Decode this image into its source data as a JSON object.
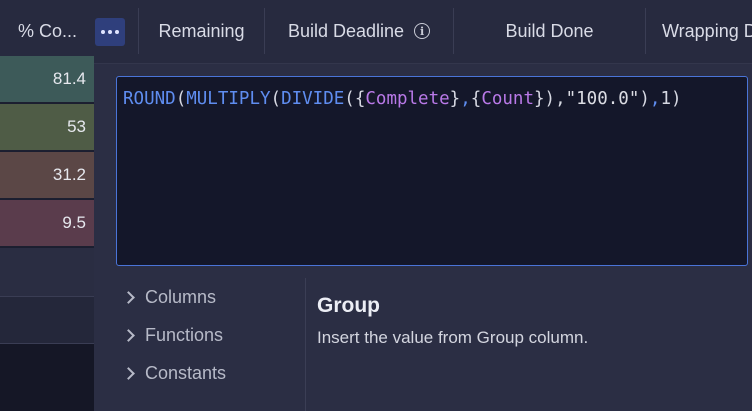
{
  "header": {
    "columns": [
      {
        "label": "% Co..."
      },
      {
        "label": "Remaining"
      },
      {
        "label": "Build Deadline"
      },
      {
        "label": "Build Done"
      },
      {
        "label": "Wrapping D"
      }
    ],
    "menu_icon": "ellipsis-icon",
    "info_icon": "info-icon"
  },
  "rows": [
    {
      "value": "81.4",
      "color": "#3d5a59"
    },
    {
      "value": "53",
      "color": "#4f5c46"
    },
    {
      "value": "31.2",
      "color": "#5b4746"
    },
    {
      "value": "9.5",
      "color": "#5a3c4c"
    }
  ],
  "editor": {
    "formula_tokens": [
      {
        "t": "fn",
        "v": "ROUND"
      },
      {
        "t": "p",
        "v": "("
      },
      {
        "t": "fn",
        "v": "MULTIPLY"
      },
      {
        "t": "p",
        "v": "("
      },
      {
        "t": "fn",
        "v": "DIVIDE"
      },
      {
        "t": "p",
        "v": "({"
      },
      {
        "t": "col",
        "v": "Complete"
      },
      {
        "t": "p",
        "v": "}"
      },
      {
        "t": "fn",
        "v": ","
      },
      {
        "t": "p",
        "v": "{"
      },
      {
        "t": "col",
        "v": "Count"
      },
      {
        "t": "p",
        "v": "}),"
      },
      {
        "t": "str",
        "v": "\"100.0\""
      },
      {
        "t": "p",
        "v": ")"
      },
      {
        "t": "fn",
        "v": ","
      },
      {
        "t": "p",
        "v": "1)"
      }
    ]
  },
  "sidebar": {
    "items": [
      {
        "label": "Columns"
      },
      {
        "label": "Functions"
      },
      {
        "label": "Constants"
      }
    ]
  },
  "detail": {
    "title": "Group",
    "description": "Insert the value from Group column."
  },
  "colors": {
    "accent": "#4a74d8",
    "function": "#5f8df0",
    "column_ref": "#b979e8"
  }
}
